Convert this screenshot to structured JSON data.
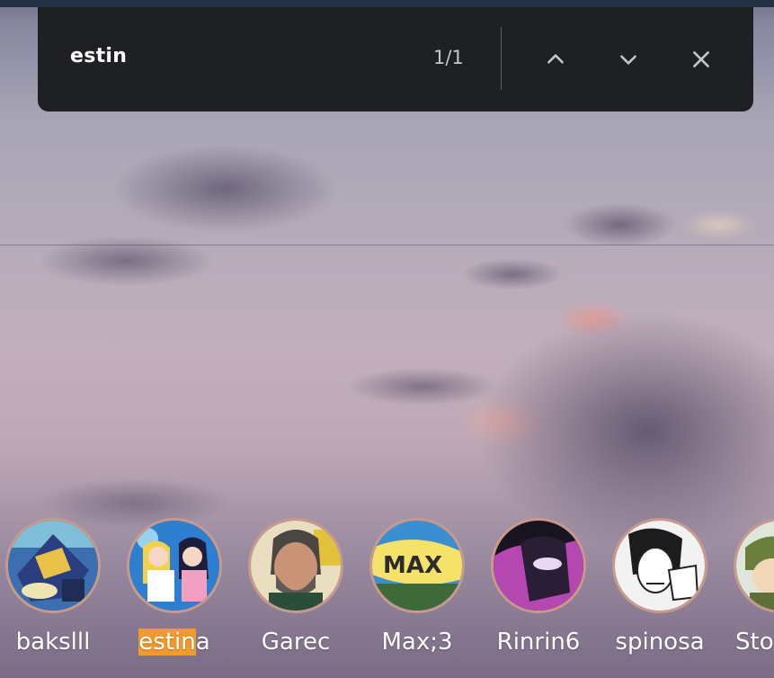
{
  "find_bar": {
    "query": "estin",
    "match_count": "1/1",
    "prev_icon": "chevron-up-icon",
    "next_icon": "chevron-down-icon",
    "close_icon": "close-icon"
  },
  "stories": [
    {
      "name": "bakslll"
    },
    {
      "name_highlight": "estin",
      "name_rest": "a"
    },
    {
      "name": "Garec"
    },
    {
      "name": "Max;3"
    },
    {
      "name": "Rinrin6"
    },
    {
      "name": "spinosa"
    },
    {
      "name": "Sto"
    }
  ],
  "colors": {
    "find_bar_bg": "#1e2024",
    "highlight": "#f29a2e",
    "avatar_ring": "#c89a8e"
  }
}
